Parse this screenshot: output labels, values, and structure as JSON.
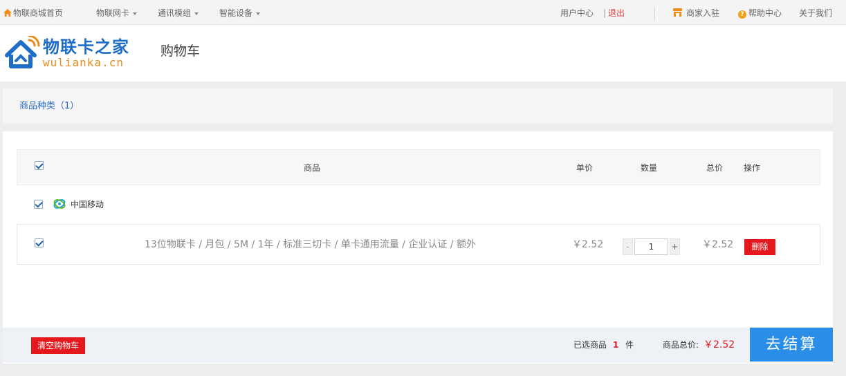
{
  "topbar": {
    "home": "物联商城首页",
    "menu": [
      "物联网卡",
      "通讯模组",
      "智能设备"
    ],
    "user_center": "用户中心",
    "logout": "退出",
    "merchant": "商家入驻",
    "help": "帮助中心",
    "about": "关于我们"
  },
  "header": {
    "logo_cn": "物联卡之家",
    "logo_en": "wulianka.cn",
    "page_title": "购物车"
  },
  "category": {
    "label": "商品种类（1）"
  },
  "table": {
    "headers": {
      "product": "商品",
      "unit_price": "单价",
      "quantity": "数量",
      "total": "总价",
      "action": "操作"
    }
  },
  "shop": {
    "name": "中国移动",
    "checked": true
  },
  "items": [
    {
      "name": "13位物联卡 / 月包 / 5M / 1年 / 标准三切卡 / 单卡通用流量 / 企业认证 / 额外",
      "unit_price": "￥2.52",
      "quantity": "1",
      "subtotal": "￥2.52",
      "delete_label": "删除",
      "checked": true
    }
  ],
  "footer": {
    "clear_label": "清空购物车",
    "selected_prefix": "已选商品",
    "selected_count": "1",
    "selected_unit": "件",
    "total_label": "商品总价:",
    "total_value": "￥2.52",
    "checkout_label": "去结算"
  },
  "colors": {
    "accent_blue": "#2a8ee8",
    "danger_red": "#e4191e",
    "logo_blue": "#1e6ec8",
    "logo_orange": "#e78a1d"
  }
}
